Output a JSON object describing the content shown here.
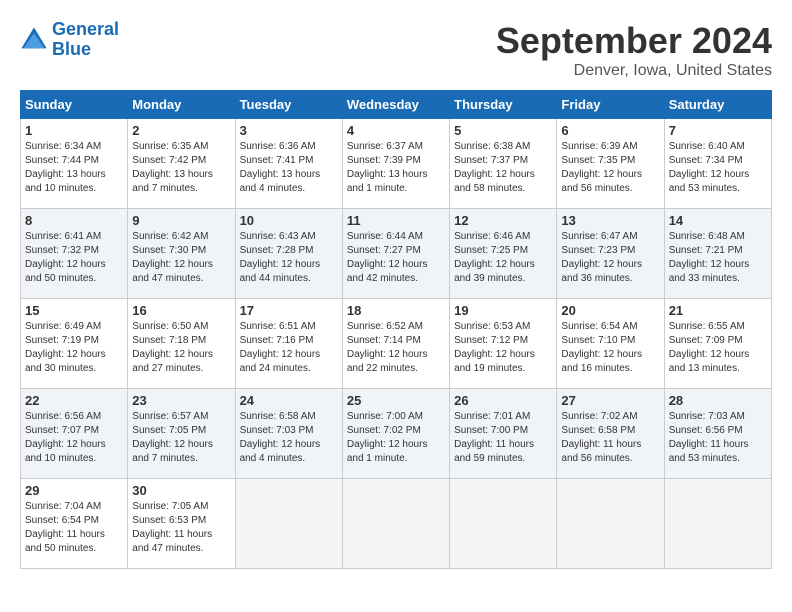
{
  "logo": {
    "text_general": "General",
    "text_blue": "Blue"
  },
  "header": {
    "month": "September 2024",
    "location": "Denver, Iowa, United States"
  },
  "days_of_week": [
    "Sunday",
    "Monday",
    "Tuesday",
    "Wednesday",
    "Thursday",
    "Friday",
    "Saturday"
  ],
  "weeks": [
    [
      {
        "day": "1",
        "sunrise": "6:34 AM",
        "sunset": "7:44 PM",
        "daylight": "13 hours and 10 minutes."
      },
      {
        "day": "2",
        "sunrise": "6:35 AM",
        "sunset": "7:42 PM",
        "daylight": "13 hours and 7 minutes."
      },
      {
        "day": "3",
        "sunrise": "6:36 AM",
        "sunset": "7:41 PM",
        "daylight": "13 hours and 4 minutes."
      },
      {
        "day": "4",
        "sunrise": "6:37 AM",
        "sunset": "7:39 PM",
        "daylight": "13 hours and 1 minute."
      },
      {
        "day": "5",
        "sunrise": "6:38 AM",
        "sunset": "7:37 PM",
        "daylight": "12 hours and 58 minutes."
      },
      {
        "day": "6",
        "sunrise": "6:39 AM",
        "sunset": "7:35 PM",
        "daylight": "12 hours and 56 minutes."
      },
      {
        "day": "7",
        "sunrise": "6:40 AM",
        "sunset": "7:34 PM",
        "daylight": "12 hours and 53 minutes."
      }
    ],
    [
      {
        "day": "8",
        "sunrise": "6:41 AM",
        "sunset": "7:32 PM",
        "daylight": "12 hours and 50 minutes."
      },
      {
        "day": "9",
        "sunrise": "6:42 AM",
        "sunset": "7:30 PM",
        "daylight": "12 hours and 47 minutes."
      },
      {
        "day": "10",
        "sunrise": "6:43 AM",
        "sunset": "7:28 PM",
        "daylight": "12 hours and 44 minutes."
      },
      {
        "day": "11",
        "sunrise": "6:44 AM",
        "sunset": "7:27 PM",
        "daylight": "12 hours and 42 minutes."
      },
      {
        "day": "12",
        "sunrise": "6:46 AM",
        "sunset": "7:25 PM",
        "daylight": "12 hours and 39 minutes."
      },
      {
        "day": "13",
        "sunrise": "6:47 AM",
        "sunset": "7:23 PM",
        "daylight": "12 hours and 36 minutes."
      },
      {
        "day": "14",
        "sunrise": "6:48 AM",
        "sunset": "7:21 PM",
        "daylight": "12 hours and 33 minutes."
      }
    ],
    [
      {
        "day": "15",
        "sunrise": "6:49 AM",
        "sunset": "7:19 PM",
        "daylight": "12 hours and 30 minutes."
      },
      {
        "day": "16",
        "sunrise": "6:50 AM",
        "sunset": "7:18 PM",
        "daylight": "12 hours and 27 minutes."
      },
      {
        "day": "17",
        "sunrise": "6:51 AM",
        "sunset": "7:16 PM",
        "daylight": "12 hours and 24 minutes."
      },
      {
        "day": "18",
        "sunrise": "6:52 AM",
        "sunset": "7:14 PM",
        "daylight": "12 hours and 22 minutes."
      },
      {
        "day": "19",
        "sunrise": "6:53 AM",
        "sunset": "7:12 PM",
        "daylight": "12 hours and 19 minutes."
      },
      {
        "day": "20",
        "sunrise": "6:54 AM",
        "sunset": "7:10 PM",
        "daylight": "12 hours and 16 minutes."
      },
      {
        "day": "21",
        "sunrise": "6:55 AM",
        "sunset": "7:09 PM",
        "daylight": "12 hours and 13 minutes."
      }
    ],
    [
      {
        "day": "22",
        "sunrise": "6:56 AM",
        "sunset": "7:07 PM",
        "daylight": "12 hours and 10 minutes."
      },
      {
        "day": "23",
        "sunrise": "6:57 AM",
        "sunset": "7:05 PM",
        "daylight": "12 hours and 7 minutes."
      },
      {
        "day": "24",
        "sunrise": "6:58 AM",
        "sunset": "7:03 PM",
        "daylight": "12 hours and 4 minutes."
      },
      {
        "day": "25",
        "sunrise": "7:00 AM",
        "sunset": "7:02 PM",
        "daylight": "12 hours and 1 minute."
      },
      {
        "day": "26",
        "sunrise": "7:01 AM",
        "sunset": "7:00 PM",
        "daylight": "11 hours and 59 minutes."
      },
      {
        "day": "27",
        "sunrise": "7:02 AM",
        "sunset": "6:58 PM",
        "daylight": "11 hours and 56 minutes."
      },
      {
        "day": "28",
        "sunrise": "7:03 AM",
        "sunset": "6:56 PM",
        "daylight": "11 hours and 53 minutes."
      }
    ],
    [
      {
        "day": "29",
        "sunrise": "7:04 AM",
        "sunset": "6:54 PM",
        "daylight": "11 hours and 50 minutes."
      },
      {
        "day": "30",
        "sunrise": "7:05 AM",
        "sunset": "6:53 PM",
        "daylight": "11 hours and 47 minutes."
      },
      null,
      null,
      null,
      null,
      null
    ]
  ]
}
